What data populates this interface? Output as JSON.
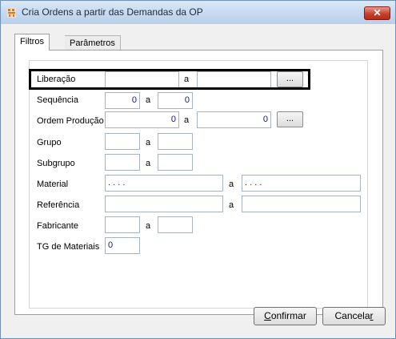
{
  "window": {
    "title": "Cria Ordens a partir das Demandas da OP",
    "close_label": "✕"
  },
  "tabs": [
    {
      "label": "Filtros",
      "active": true
    },
    {
      "label": "Parâmetros",
      "active": false
    }
  ],
  "form": {
    "liberacao": {
      "label": "Liberação",
      "from": "",
      "sep": "a",
      "to": "",
      "button": "..."
    },
    "sequencia": {
      "label": "Sequência",
      "from": "0",
      "sep": "a",
      "to": "0"
    },
    "ordem_producao": {
      "label": "Ordem Produção",
      "from": "0",
      "sep": "a",
      "to": "0",
      "button": "..."
    },
    "grupo": {
      "label": "Grupo",
      "from": "",
      "sep": "a",
      "to": ""
    },
    "subgrupo": {
      "label": "Subgrupo",
      "from": "",
      "sep": "a",
      "to": ""
    },
    "material": {
      "label": "Material",
      "from": ".   .   .   .",
      "sep": "a",
      "to": ".   .   .   ."
    },
    "referencia": {
      "label": "Referência",
      "from": "",
      "sep": "a",
      "to": ""
    },
    "fabricante": {
      "label": "Fabricante",
      "from": "",
      "sep": "a",
      "to": ""
    },
    "tg_materiais": {
      "label": "TG de Materiais",
      "value": "0"
    }
  },
  "buttons": {
    "confirmar_pre": "",
    "confirmar_u": "C",
    "confirmar_rest": "onfirmar",
    "cancelar_pre": "Cancela",
    "cancelar_u": "r",
    "cancelar_rest": ""
  },
  "colors": {
    "field_text": "#0a1a8a",
    "close_button": "#c8412c",
    "titlebar": "#c4d8ef"
  }
}
